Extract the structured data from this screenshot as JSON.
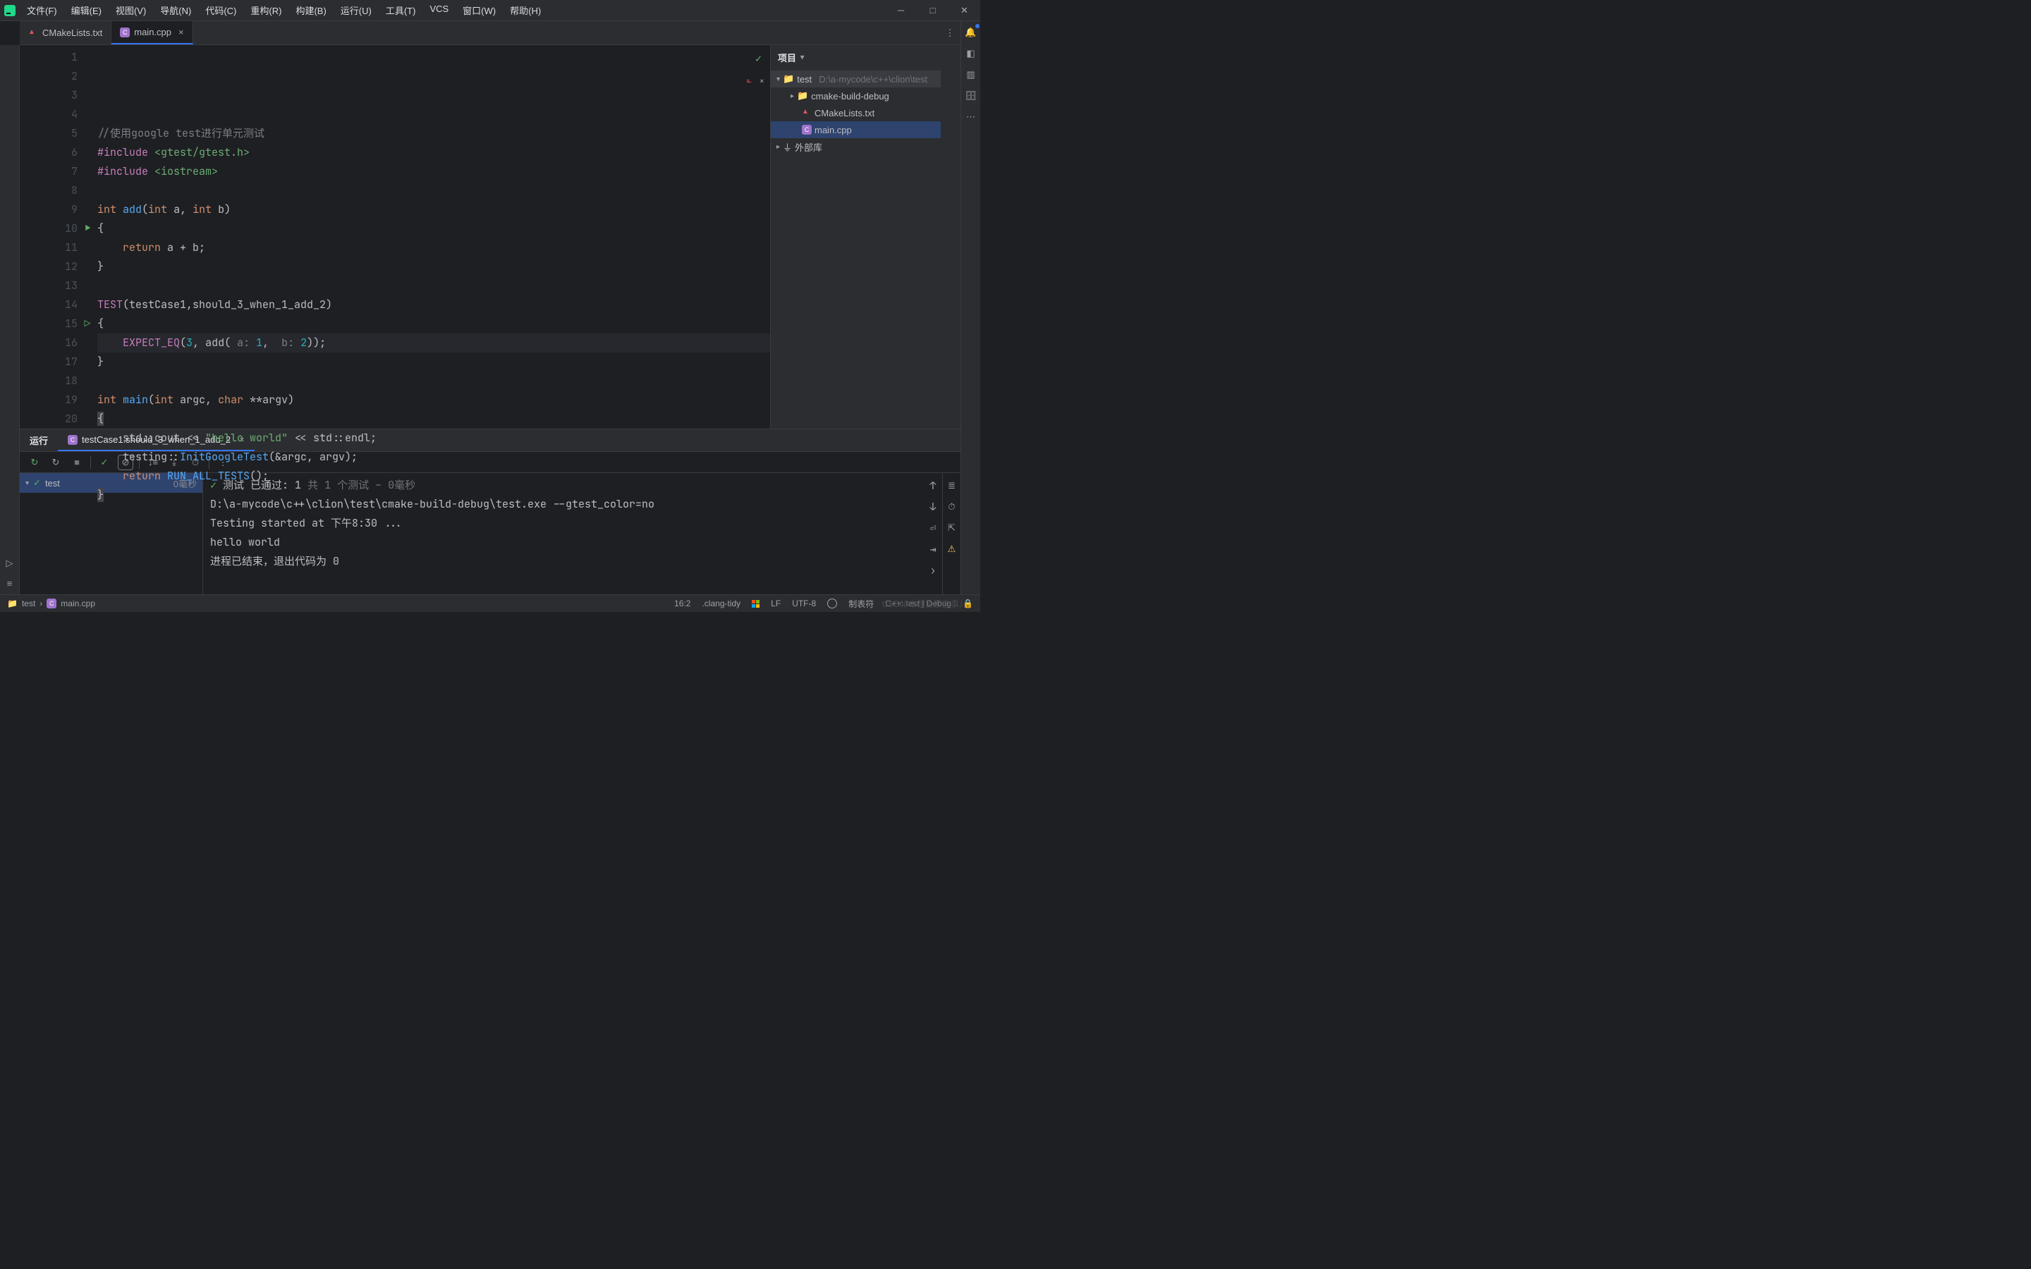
{
  "menu": [
    "文件(F)",
    "编辑(E)",
    "视图(V)",
    "导航(N)",
    "代码(C)",
    "重构(R)",
    "构建(B)",
    "运行(U)",
    "工具(T)",
    "VCS",
    "窗口(W)",
    "帮助(H)"
  ],
  "tabs": [
    {
      "name": "CMakeLists.txt",
      "active": false
    },
    {
      "name": "main.cpp",
      "active": true
    }
  ],
  "code_lines": 20,
  "code": {
    "l1": "//使用google test进行单元测试",
    "l2a": "#include",
    "l2b": " <gtest/gtest.h>",
    "l3a": "#include",
    "l3b": " <iostream>",
    "l5_int": "int",
    "l5_fn": " add",
    "l5_p": "(",
    "l5_int2": "int",
    "l5_a": " a, ",
    "l5_int3": "int",
    "l5_b": " b",
    "l5_cp": ")",
    "l6": "{",
    "l7_ret": "return",
    "l7_rest": " a + b;",
    "l8": "}",
    "l10_T": "TEST",
    "l10_args": "(testCase1,should_3_when_1_add_2)",
    "l11": "{",
    "l12_exp": "EXPECT_EQ",
    "l12_a": "(",
    "l12_3": "3",
    "l12_c": ", add( ",
    "l12_ah": "a:",
    "l12_1": " 1",
    "l12_cc": ",  ",
    "l12_bh": "b:",
    "l12_2": " 2",
    "l12_end": "));",
    "l13": "}",
    "l15_int": "int",
    "l15_fn": " main",
    "l15_p": "(",
    "l15_int2": "int",
    "l15_argc": " argc, ",
    "l15_char": "char",
    "l15_argv": " **argv",
    "l15_cp": ")",
    "l16": "{",
    "l17_a": "std::cout << ",
    "l17_s": "\"hello world\"",
    "l17_b": " << std::endl;",
    "l18_a": "testing::",
    "l18_f": "InitGoogleTest",
    "l18_b": "(&argc, argv);",
    "l19_ret": "return",
    "l19_f": " RUN_ALL_TESTS",
    "l19_b": "();",
    "l20": "}"
  },
  "project": {
    "title": "项目",
    "root": "test",
    "root_path": "D:\\a-mycode\\c++\\clion\\test",
    "children": [
      {
        "name": "cmake-build-debug",
        "icon": "folder",
        "expandable": true
      },
      {
        "name": "CMakeLists.txt",
        "icon": "cmake"
      },
      {
        "name": "main.cpp",
        "icon": "cpp",
        "selected": true
      }
    ],
    "ext": "外部库"
  },
  "run": {
    "title": "运行",
    "config": "testCase1.should_3_when_1_add_2",
    "tree_root": "test",
    "duration": "0毫秒",
    "summary_pre": "测试 已通过: 1",
    "summary_post": "共 1 个测试 – 0毫秒",
    "out1": "D:\\a-mycode\\c++\\clion\\test\\cmake-build-debug\\test.exe --gtest_color=no",
    "out2": "Testing started at 下午8:30 ...",
    "out3": "hello world",
    "out4": "进程已结束，退出代码为 0"
  },
  "breadcrumb": {
    "a": "test",
    "b": "main.cpp"
  },
  "status": {
    "pos": "16:2",
    "tidy": ".clang-tidy",
    "lf": "LF",
    "enc": "UTF-8",
    "indent": "制表符",
    "cfg": "C++: test | Debug",
    "watermark": "CSDN 本想鱼那些事儿"
  }
}
